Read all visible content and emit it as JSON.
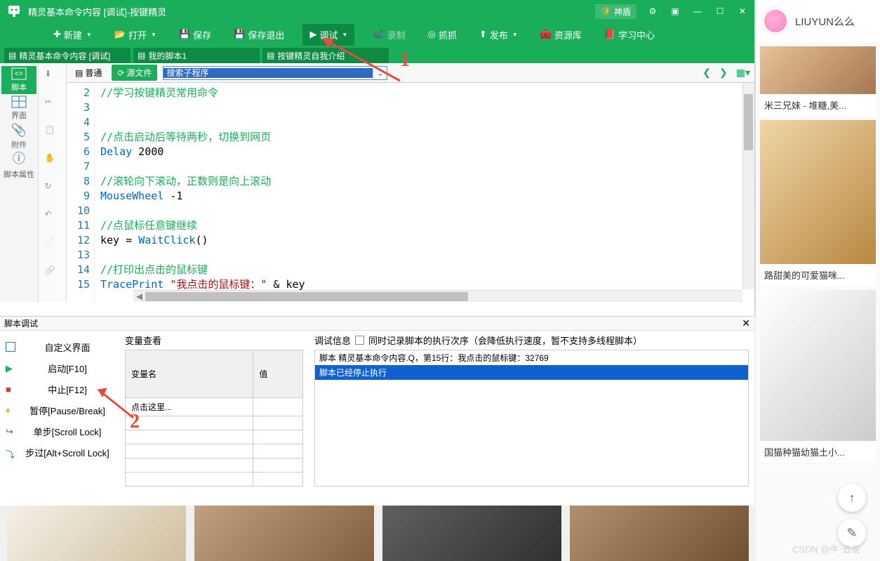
{
  "titlebar": {
    "title": "精灵基本命令内容 [调试]-按键精灵",
    "shield": "神盾"
  },
  "toolbar": {
    "new": "新建",
    "open": "打开",
    "save": "保存",
    "save_exit": "保存退出",
    "debug": "调试",
    "record": "录制",
    "zhuazhua": "抓抓",
    "publish": "发布",
    "resource": "资源库",
    "study": "学习中心"
  },
  "tabs": [
    {
      "label": "精灵基本命令内容 [调试]"
    },
    {
      "label": "我的脚本1"
    },
    {
      "label": "按键精灵自我介绍"
    }
  ],
  "sidebar": {
    "script": "脚本",
    "ui": "界面",
    "attach": "附件",
    "prop": "脚本属性"
  },
  "editor_toolbar": {
    "normal": "普通",
    "source": "源文件",
    "search_placeholder": "搜索子程序"
  },
  "gutter_lines": [
    "2",
    "3",
    "4",
    "5",
    "6",
    "7",
    "8",
    "9",
    "10",
    "11",
    "12",
    "13",
    "14",
    "15"
  ],
  "debug_panel": {
    "title": "脚本调试",
    "custom_ui": "自定义界面",
    "start": "启动[F10]",
    "stop": "中止[F12]",
    "pause": "暂停[Pause/Break]",
    "step": "单步[Scroll Lock]",
    "step_over": "步过[Alt+Scroll Lock]",
    "var_title": "变量查看",
    "var_col1": "变量名",
    "var_col2": "值",
    "var_hint": "点击这里...",
    "info_title": "调试信息",
    "info_chk_label": "同时记录脚本的执行次序（会降低执行速度，暂不支持多线程脚本）",
    "info_line1": "脚本 精灵基本命令内容.Q，第15行：我点击的鼠标键：32769",
    "info_line2": "脚本已经停止执行"
  },
  "right": {
    "username": "LIUYUN么么",
    "cap1": "米三兄妹 - 堆糖,美...",
    "cap2": "路甜美的可爱猫咪...",
    "cap3": "国猫种猫幼猫土小..."
  },
  "watermark": "CSDN @牛·云说",
  "annotations": {
    "one": "1",
    "two": "2"
  }
}
